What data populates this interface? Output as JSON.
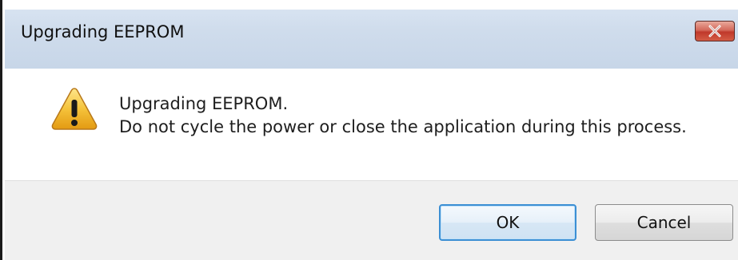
{
  "window": {
    "title": "Upgrading EEPROM",
    "close_icon": "close-icon",
    "close_color": "#c7463a"
  },
  "message": {
    "icon": "warning-icon",
    "line1": "Upgrading EEPROM.",
    "line2": "Do not cycle the power or close the application during this process."
  },
  "buttons": {
    "ok_label": "OK",
    "cancel_label": "Cancel"
  },
  "colors": {
    "titlebar": "#cfdcec",
    "footer": "#f0f0f0",
    "ok_border": "#3c8fd4",
    "warning_fill": "#f5c33b"
  }
}
